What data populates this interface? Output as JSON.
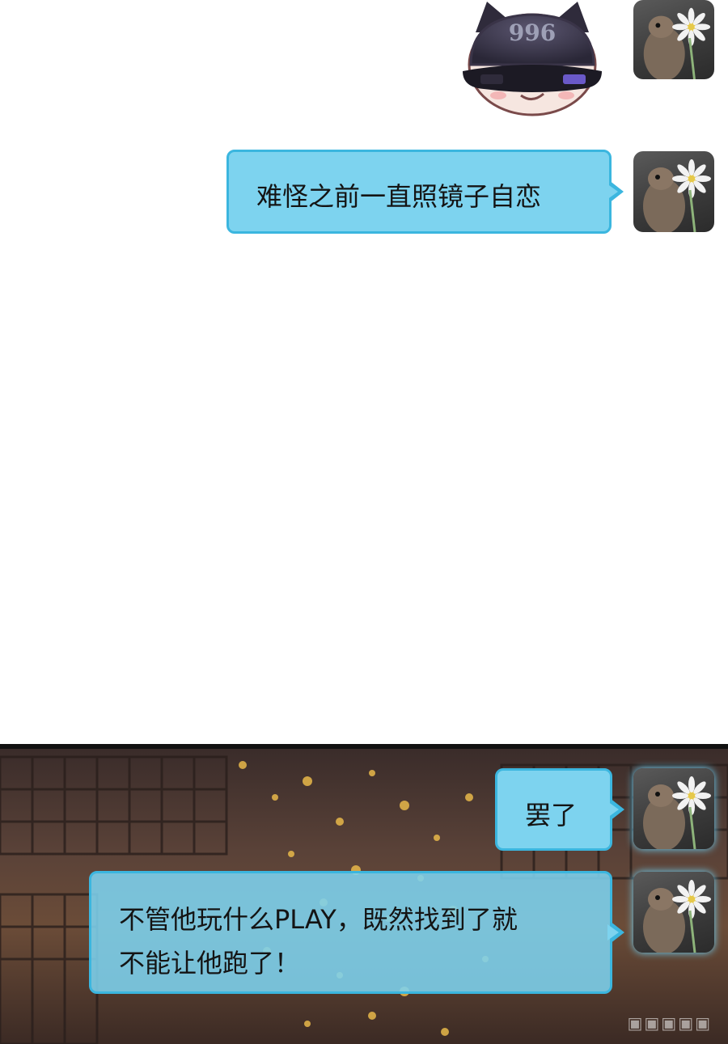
{
  "messages": [
    {
      "text": "难怪之前一直照镜子自恋"
    },
    {
      "text": "罢了"
    },
    {
      "text": "不管他玩什么PLAY，既然找到了就",
      "text2": "不能让他跑了！"
    }
  ],
  "sticker": {
    "badge_text": "996"
  },
  "colors": {
    "bubble_fill": "#7dd3ef",
    "bubble_border": "#3bb6df",
    "scene_dark": "#3a2c2a",
    "scene_glow": "#e8b84a"
  },
  "icons": {
    "avatar": "squirrel-with-daisy-avatar",
    "sticker": "masked-cat-sticker"
  }
}
